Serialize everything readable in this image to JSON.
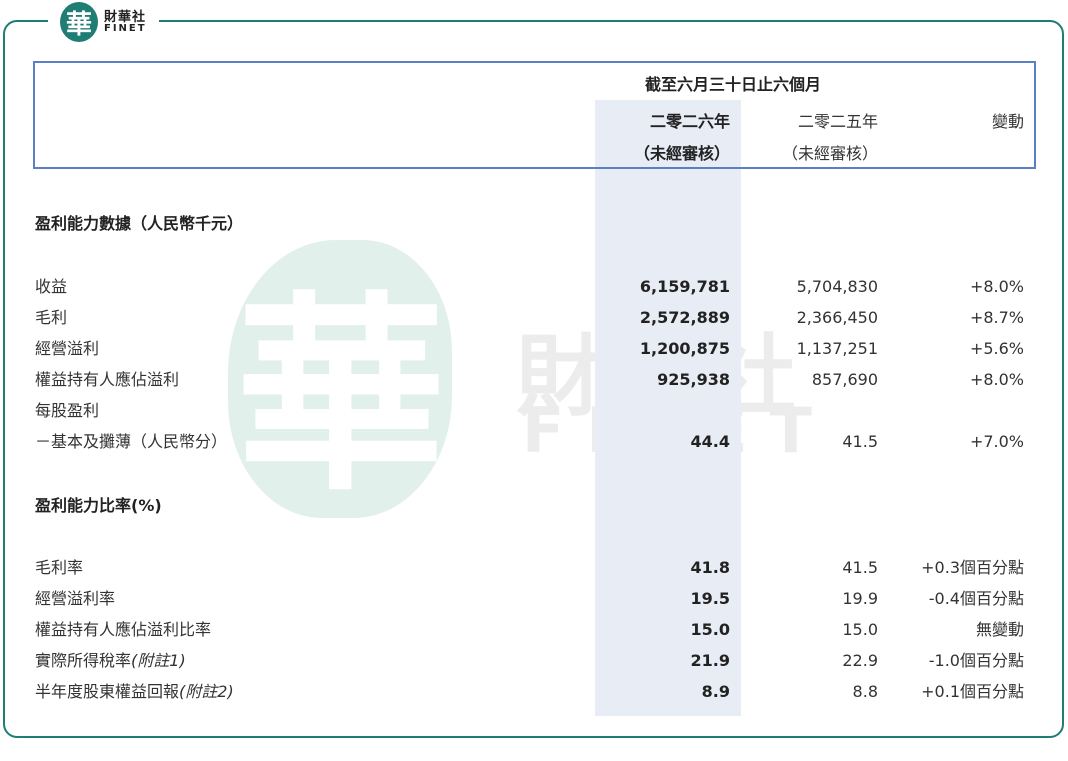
{
  "logo": {
    "glyph": "華",
    "name_cn": "財華社",
    "name_en": "FINET"
  },
  "watermark": {
    "glyph": "華",
    "name_cn": "財華社",
    "name_en": "FINET"
  },
  "header": {
    "period": "截至六月三十日止六個月",
    "col1_year": "二零二六年",
    "col1_note": "（未經審核）",
    "col2_year": "二零二五年",
    "col2_note": "（未經審核）",
    "col3": "變動"
  },
  "sections": [
    {
      "title": "盈利能力數據（人民幣千元）",
      "rows": [
        {
          "label": "收益",
          "v2026": "6,159,781",
          "v2025": "5,704,830",
          "change": "+8.0%"
        },
        {
          "label": "毛利",
          "v2026": "2,572,889",
          "v2025": "2,366,450",
          "change": "+8.7%"
        },
        {
          "label": "經營溢利",
          "v2026": "1,200,875",
          "v2025": "1,137,251",
          "change": "+5.6%"
        },
        {
          "label": "權益持有人應佔溢利",
          "v2026": "925,938",
          "v2025": "857,690",
          "change": "+8.0%"
        },
        {
          "label": "每股盈利",
          "v2026": "",
          "v2025": "",
          "change": ""
        },
        {
          "label": "－基本及攤薄（人民幣分）",
          "v2026": "44.4",
          "v2025": "41.5",
          "change": "+7.0%"
        }
      ]
    },
    {
      "title": "盈利能力比率(%)",
      "rows": [
        {
          "label": "毛利率",
          "v2026": "41.8",
          "v2025": "41.5",
          "change": "+0.3個百分點"
        },
        {
          "label": "經營溢利率",
          "v2026": "19.5",
          "v2025": "19.9",
          "change": "-0.4個百分點"
        },
        {
          "label": "權益持有人應佔溢利比率",
          "v2026": "15.0",
          "v2025": "15.0",
          "change": "無變動"
        },
        {
          "label": "實際所得稅率",
          "note": "(附註1)",
          "v2026": "21.9",
          "v2025": "22.9",
          "change": "-1.0個百分點"
        },
        {
          "label": "半年度股東權益回報",
          "note": "(附註2)",
          "v2026": "8.9",
          "v2025": "8.8",
          "change": "+0.1個百分點"
        }
      ]
    }
  ]
}
